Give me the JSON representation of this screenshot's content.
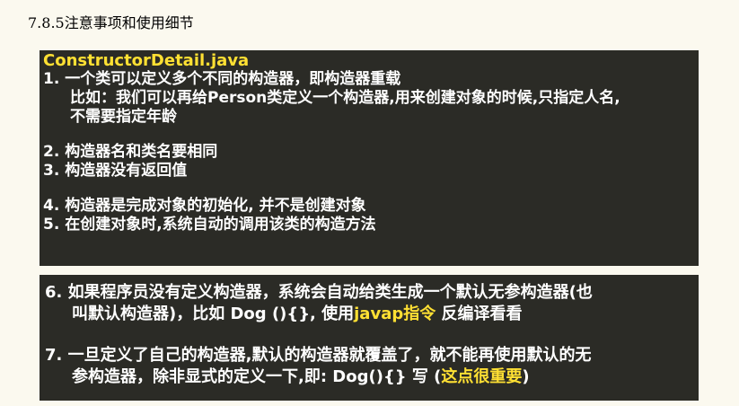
{
  "heading": "7.8.5注意事项和使用细节",
  "panel1": {
    "title": "ConstructorDetail.java",
    "item1": "1.  一个类可以定义多个不同的构造器，即构造器重载",
    "item1_detail_a": "比如：我们可以再给Person类定义一个构造器,用来创建对象的时候,只指定人名,",
    "item1_detail_b": "不需要指定年龄",
    "item2": "2. 构造器名和类名要相同",
    "item3": "3. 构造器没有返回值",
    "item4": "4. 构造器是完成对象的初始化, 并不是创建对象",
    "item5": "5. 在创建对象时,系统自动的调用该类的构造方法"
  },
  "panel2": {
    "item6_a": "6.  如果程序员没有定义构造器，系统会自动给类生成一个默认无参构造器(也",
    "item6_b_pre": "叫默认构造器)，比如 Dog (){}, 使用",
    "item6_b_hl": "javap指令",
    "item6_b_post": " 反编译看看",
    "item7_a": "7.  一旦定义了自己的构造器,默认的构造器就覆盖了，就不能再使用默认的无",
    "item7_b_pre": "参构造器，除非显式的定义一下,即: Dog(){}  写 (",
    "item7_b_hl": "这点很重要",
    "item7_b_post": ")"
  }
}
